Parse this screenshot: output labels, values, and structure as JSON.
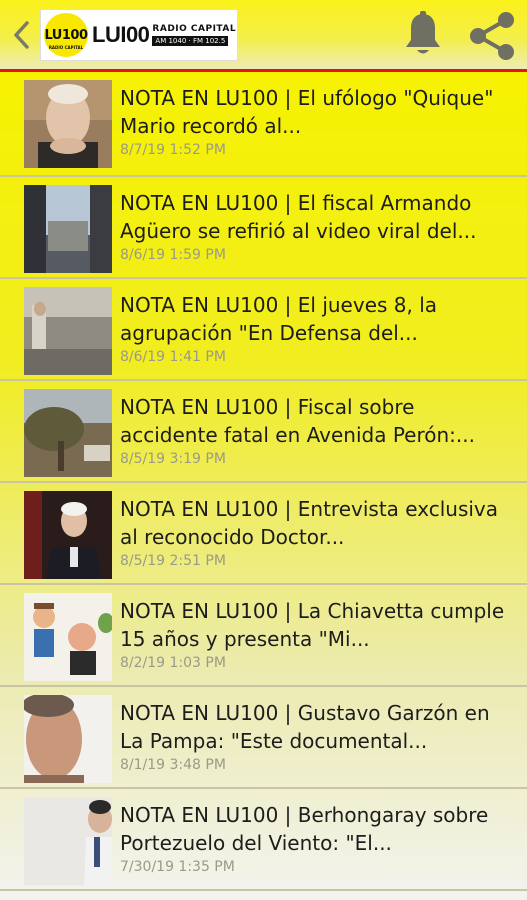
{
  "header": {
    "logo_disc": "LU100",
    "logo_disc_sub": "RADIO CAPITAL",
    "logo_name": "LUI00",
    "logo_radio": "RADIO CAPITAL",
    "logo_freq": "AM 1040 · FM 102.5",
    "accent_red": "#e3141a",
    "accent_yellow": "#f6f200"
  },
  "items": [
    {
      "title": "NOTA EN LU100 | El ufólogo \"Quique\" Mario recordó al...",
      "date": "8/7/19 1:52 PM"
    },
    {
      "title": "NOTA EN LU100 | El fiscal Armando Agüero se refirió al video viral del...",
      "date": "8/6/19 1:59 PM"
    },
    {
      "title": "NOTA EN LU100 | El jueves 8, la agrupación \"En Defensa del...",
      "date": "8/6/19 1:41 PM"
    },
    {
      "title": "NOTA EN LU100 | Fiscal sobre accidente fatal en Avenida Perón:...",
      "date": "8/5/19 3:19 PM"
    },
    {
      "title": "NOTA EN LU100 | Entrevista exclusiva al reconocido Doctor...",
      "date": "8/5/19 2:51 PM"
    },
    {
      "title": "NOTA EN LU100 | La Chiavetta cumple 15 años y presenta \"Mi...",
      "date": "8/2/19 1:03 PM"
    },
    {
      "title": "NOTA EN LU100 | Gustavo Garzón en La Pampa: \"Este documental...",
      "date": "8/1/19 3:48 PM"
    },
    {
      "title": "NOTA EN LU100 | Berhongaray sobre Portezuelo del Viento: \"El...",
      "date": "7/30/19 1:35 PM"
    }
  ]
}
